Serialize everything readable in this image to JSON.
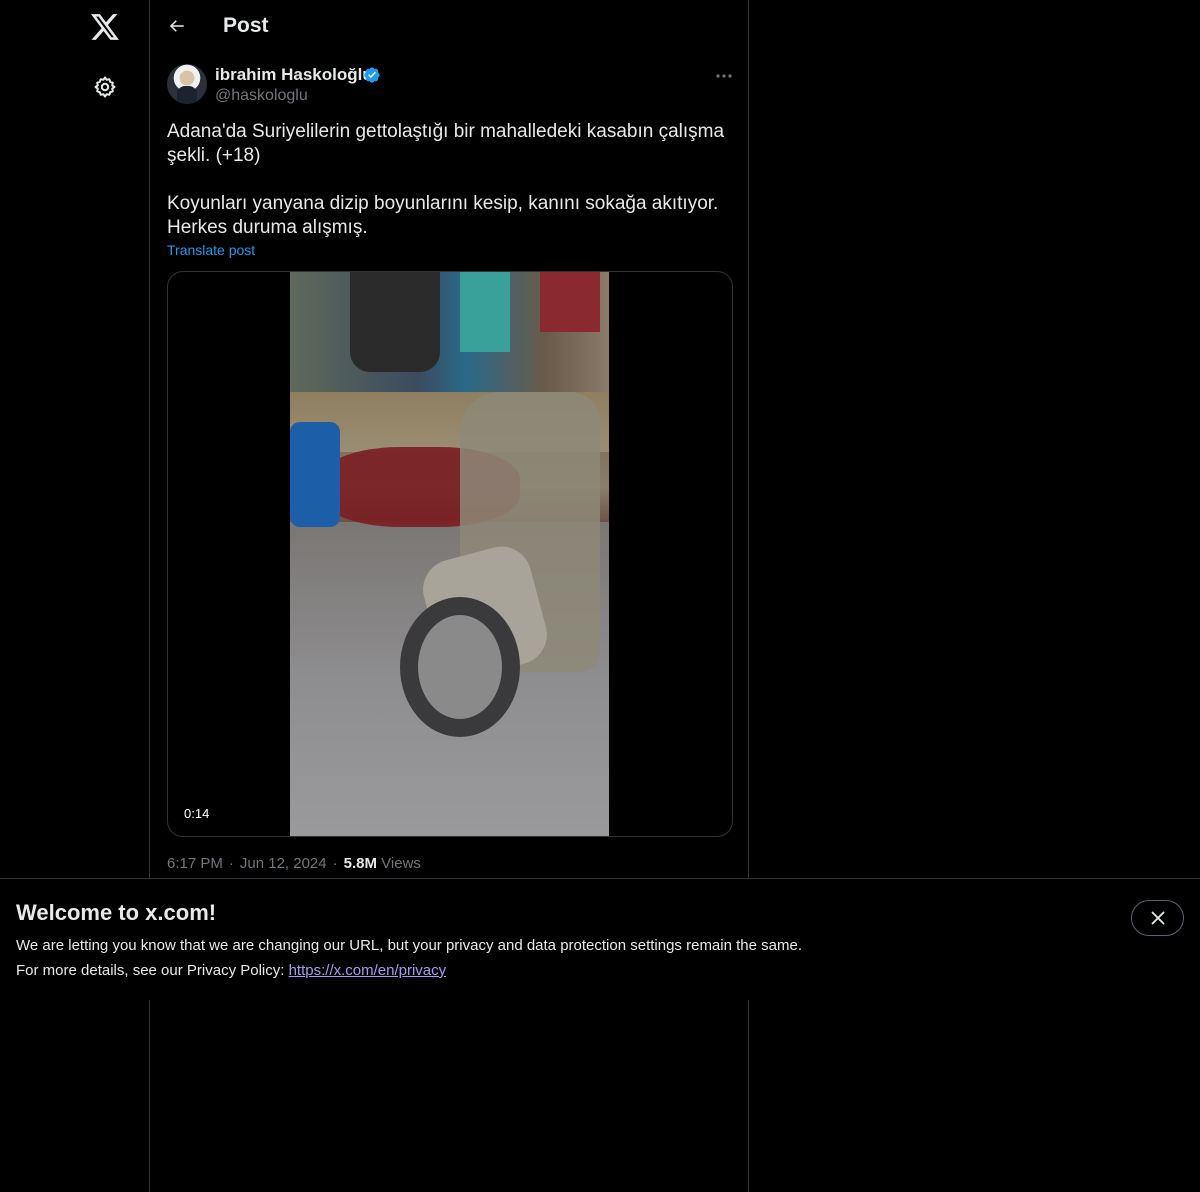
{
  "nav": {
    "logo_icon": "x-logo-icon",
    "settings_icon": "gear-icon"
  },
  "header": {
    "back_icon": "arrow-left-icon",
    "title": "Post"
  },
  "post": {
    "author_name": "ibrahim Haskoloğlu",
    "author_handle": "@haskologlu",
    "verified_icon": "verified-badge-icon",
    "more_icon": "more-horizontal-icon",
    "text_line1": "Adana'da Suriyelilerin gettolaştığı bir mahalledeki kasabın çalışma şekli. (+18)",
    "text_line2": "Koyunları yanyana dizip boyunlarını kesip, kanını sokağa akıtıyor. Herkes duruma alışmış.",
    "translate_label": "Translate post",
    "video_duration": "0:14",
    "time": "6:17 PM",
    "date": "Jun 12, 2024",
    "views_count": "5.8M",
    "views_label": "Views"
  },
  "banner": {
    "title": "Welcome to x.com!",
    "line1": "We are letting you know that we are changing our URL, but your privacy and data protection settings remain the same.",
    "line2_prefix": "For more details, see our Privacy Policy: ",
    "link_text": "https://x.com/en/privacy",
    "close_icon": "close-icon"
  },
  "colors": {
    "background": "#000000",
    "text": "#e7e9ea",
    "secondary_text": "#71767b",
    "accent_blue": "#1d9bf0",
    "link_purple": "#a59bf5",
    "border": "#2f3336"
  }
}
